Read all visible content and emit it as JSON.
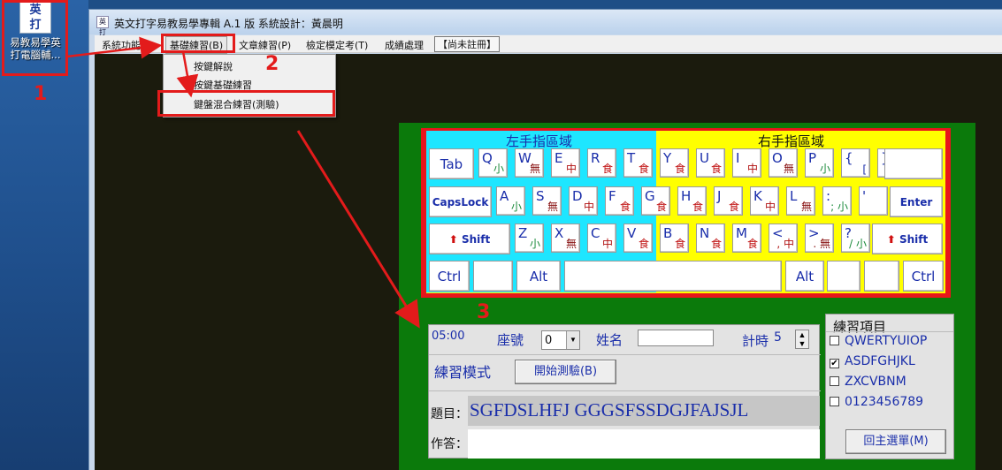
{
  "desktop": {
    "icon_glyph_top": "英",
    "icon_glyph_bottom": "打",
    "icon_label_1": "易教易學英",
    "icon_label_2": "打電腦輔..."
  },
  "window": {
    "title": "英文打字易教易學專輯 A.1 版 系統設計：黃晨明",
    "app_icon_text": "英打"
  },
  "menu": [
    "系統功能(S)",
    "基礎練習(B)",
    "文章練習(P)",
    "檢定模定考(T)",
    "成績處理",
    "【尚未註冊】"
  ],
  "dropdown": [
    "按鍵解說",
    "按鍵基礎練習",
    "鍵盤混合練習(測驗)"
  ],
  "annotations": {
    "n1": "1",
    "n2": "2",
    "n3": "3"
  },
  "keyboard": {
    "left_zone_label": "左手指區域",
    "right_zone_label": "右手指區域",
    "row1": [
      {
        "k": "Q",
        "s": "小"
      },
      {
        "k": "W",
        "s": "無"
      },
      {
        "k": "E",
        "s": "中"
      },
      {
        "k": "R",
        "s": "食"
      },
      {
        "k": "T",
        "s": "食"
      },
      {
        "k": "Y",
        "s": "食"
      },
      {
        "k": "U",
        "s": "食"
      },
      {
        "k": "I",
        "s": "中"
      },
      {
        "k": "O",
        "s": "無"
      },
      {
        "k": "P",
        "s": "小"
      },
      {
        "k": "{",
        "s": "["
      },
      {
        "k": "}",
        "s": "]"
      }
    ],
    "row2": [
      {
        "k": "A",
        "s": "小"
      },
      {
        "k": "S",
        "s": "無"
      },
      {
        "k": "D",
        "s": "中"
      },
      {
        "k": "F",
        "s": "食"
      },
      {
        "k": "G",
        "s": "食"
      },
      {
        "k": "H",
        "s": "食"
      },
      {
        "k": "J",
        "s": "食"
      },
      {
        "k": "K",
        "s": "中"
      },
      {
        "k": "L",
        "s": "無"
      },
      {
        "k": ":",
        "s": "; 小"
      },
      {
        "k": "'",
        "s": ""
      }
    ],
    "row3": [
      {
        "k": "Z",
        "s": "小"
      },
      {
        "k": "X",
        "s": "無"
      },
      {
        "k": "C",
        "s": "中"
      },
      {
        "k": "V",
        "s": "食"
      },
      {
        "k": "B",
        "s": "食"
      },
      {
        "k": "N",
        "s": "食"
      },
      {
        "k": "M",
        "s": "食"
      },
      {
        "k": "<",
        "s": ", 中"
      },
      {
        "k": ">",
        "s": ". 無"
      },
      {
        "k": "?",
        "s": "/ 小"
      }
    ],
    "tab": "Tab",
    "capslock": "CapsLock",
    "enter": "Enter",
    "shift": "Shift",
    "ctrl": "Ctrl",
    "alt": "Alt",
    "shift_arrow": "⬆"
  },
  "test_panel": {
    "timer": "05:00",
    "seat_label": "座號",
    "seat_value": "0",
    "name_label": "姓名",
    "count_label": "計時",
    "count_value": "5",
    "mode_label": "練習模式",
    "start_button": "開始測驗(B)",
    "question_label": "題目：",
    "question_text": "SGFDSLHFJ GGGSFSSDGJFAJSJL",
    "answer_label": "作答："
  },
  "options": {
    "title": "練習項目",
    "items": [
      {
        "label": "QWERTYUIOP",
        "checked": false
      },
      {
        "label": "ASDFGHJKL",
        "checked": true
      },
      {
        "label": "ZXCVBNM",
        "checked": false
      },
      {
        "label": "0123456789",
        "checked": false
      }
    ],
    "back_button": "回主選單(M)"
  }
}
